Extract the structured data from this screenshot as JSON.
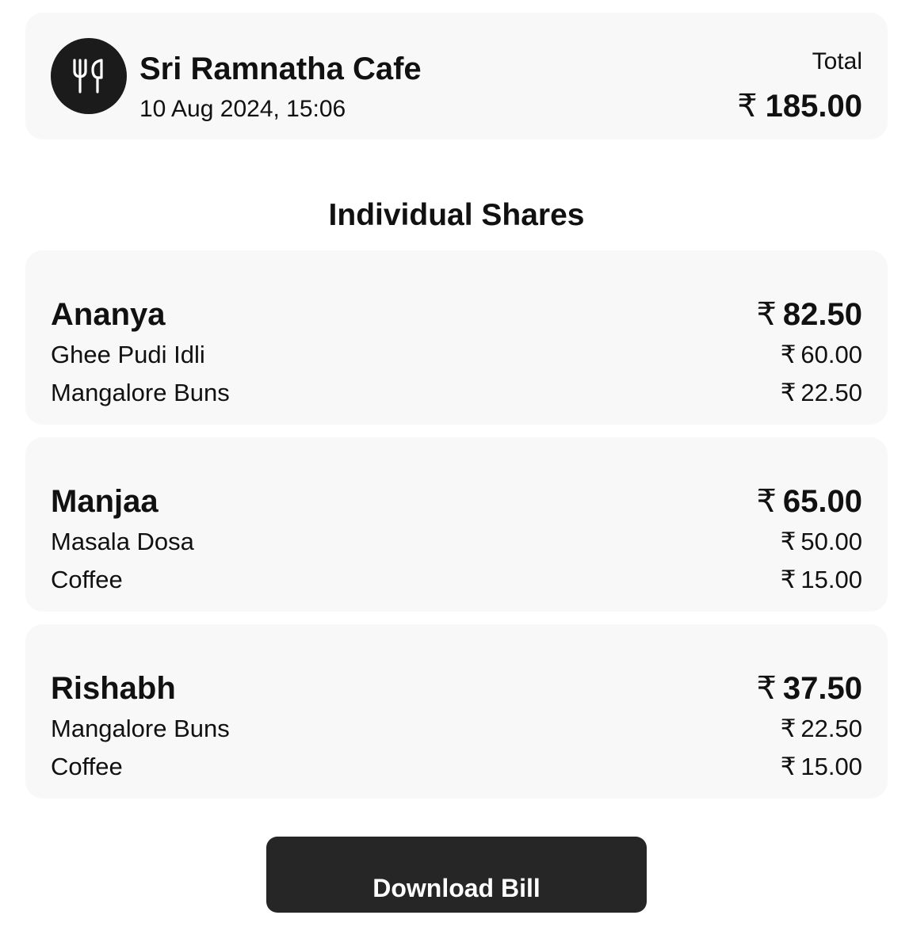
{
  "header": {
    "logo_icon": "fork-and-knife-icon",
    "restaurant_name": "Sri Ramnatha Cafe",
    "datetime": "10 Aug 2024, 15:06",
    "total_label": "Total",
    "currency_symbol": "₹",
    "total_amount": "185.00"
  },
  "section_title": "Individual Shares",
  "shares": [
    {
      "name": "Ananya",
      "total": "82.50",
      "items": [
        {
          "name": "Ghee Pudi Idli",
          "price": "60.00"
        },
        {
          "name": "Mangalore Buns",
          "price": "22.50"
        }
      ]
    },
    {
      "name": "Manjaa",
      "total": "65.00",
      "items": [
        {
          "name": "Masala Dosa",
          "price": "50.00"
        },
        {
          "name": "Coffee",
          "price": "15.00"
        }
      ]
    },
    {
      "name": "Rishabh",
      "total": "37.50",
      "items": [
        {
          "name": "Mangalore Buns",
          "price": "22.50"
        },
        {
          "name": "Coffee",
          "price": "15.00"
        }
      ]
    }
  ],
  "download_button_label": "Download Bill",
  "colors": {
    "card_background": "#f8f8f8",
    "button_background": "#262626",
    "logo_background": "#1b1b1b"
  }
}
